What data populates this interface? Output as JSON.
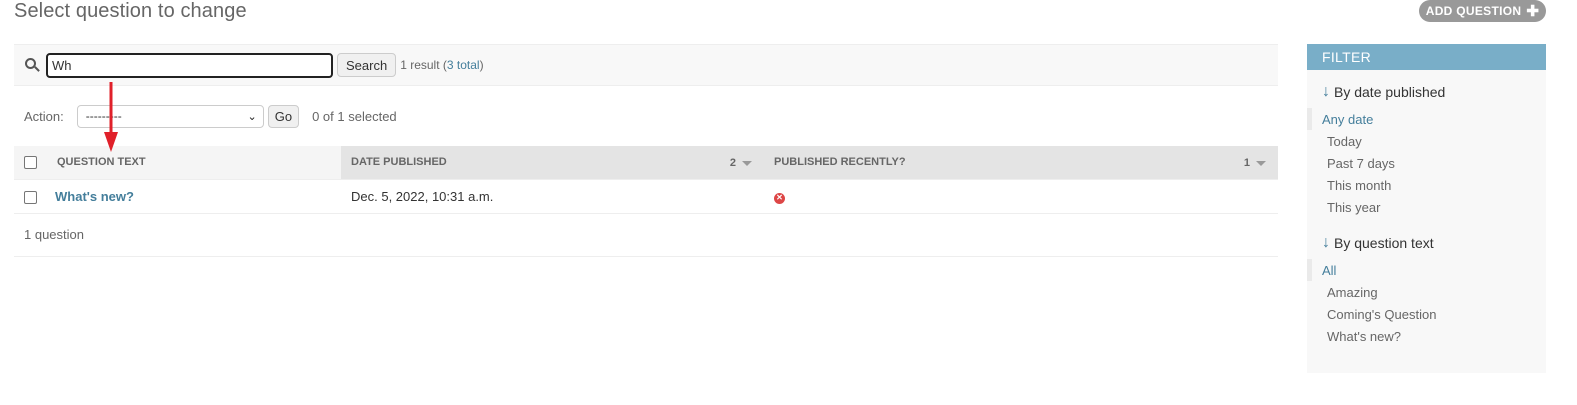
{
  "page": {
    "title": "Select question to change",
    "add_button_label": "ADD QUESTION",
    "add_button_icon": "plus-icon"
  },
  "search": {
    "value": "Wh",
    "button_label": "Search",
    "result_prefix": "1 result (",
    "total_link": "3 total",
    "result_suffix": ")",
    "icon": "search-icon"
  },
  "actions": {
    "label": "Action:",
    "selected_option": "---------",
    "go_label": "Go",
    "selected_count": "0 of 1 selected"
  },
  "table": {
    "columns": [
      {
        "label": "QUESTION TEXT",
        "sort_priority": "",
        "sorted": false
      },
      {
        "label": "DATE PUBLISHED",
        "sort_priority": "2",
        "sorted": true
      },
      {
        "label": "PUBLISHED RECENTLY?",
        "sort_priority": "1",
        "sorted": true
      }
    ],
    "rows": [
      {
        "question_text": "What's new?",
        "date_published": "Dec. 5, 2022, 10:31 a.m.",
        "published_recently": false,
        "published_recently_icon": "no-icon"
      }
    ],
    "paginator": "1 question"
  },
  "filter": {
    "header": "FILTER",
    "groups": [
      {
        "title": "By date published",
        "options": [
          "Any date",
          "Today",
          "Past 7 days",
          "This month",
          "This year"
        ],
        "selected": "Any date"
      },
      {
        "title": "By question text",
        "options": [
          "All",
          "Amazing",
          "Coming's Question",
          "What's new?"
        ],
        "selected": "All"
      }
    ]
  },
  "colors": {
    "accent": "#79aec8",
    "link": "#447e9b",
    "annotation_arrow": "#e0202a",
    "no_icon": "#dd4646"
  }
}
